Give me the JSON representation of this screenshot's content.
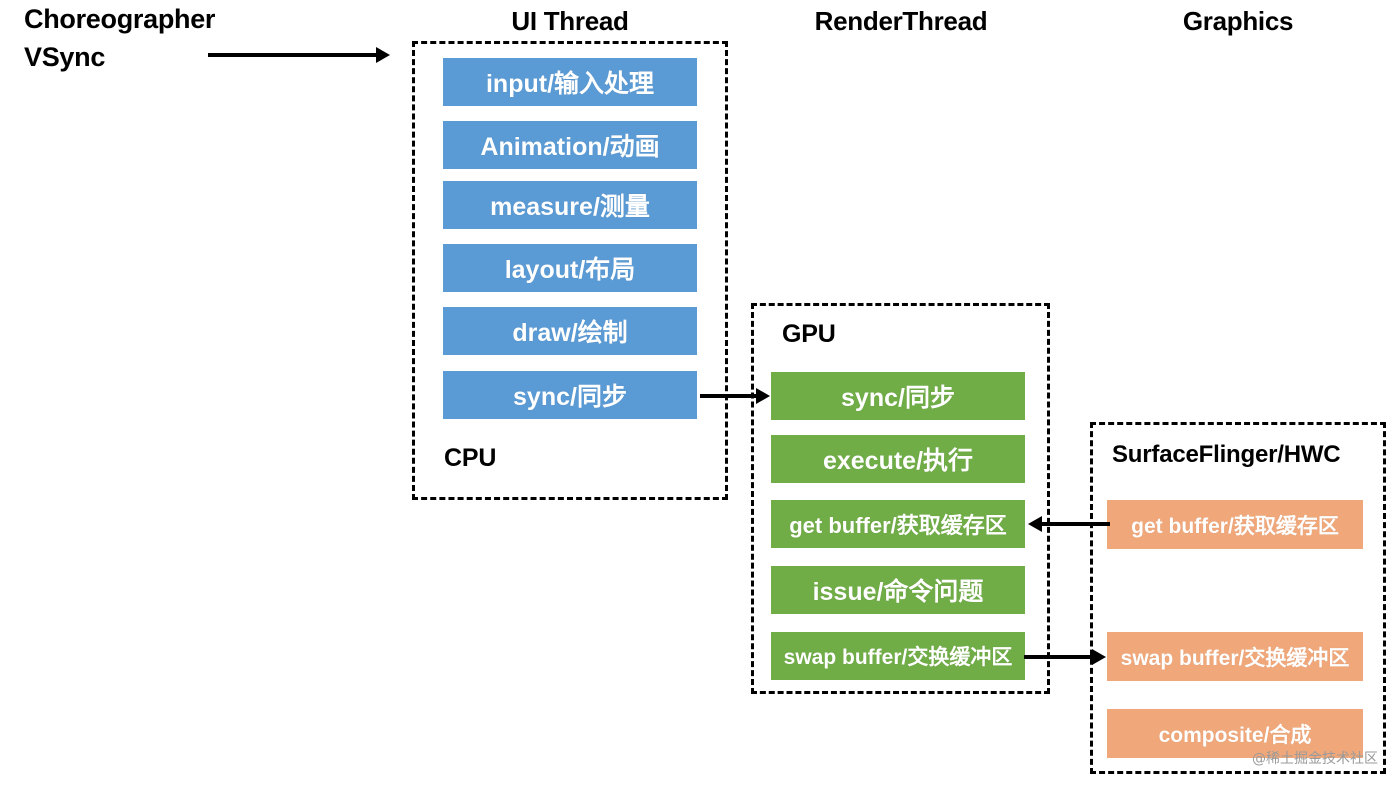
{
  "diagram": {
    "title_left": {
      "line1": "Choreographer",
      "line2": "VSync"
    },
    "column_headers": [
      {
        "label": "UI Thread"
      },
      {
        "label": "RenderThread"
      },
      {
        "label": "Graphics"
      }
    ],
    "zones": [
      {
        "id": "cpu",
        "label": "CPU",
        "label_position": "bottom-left",
        "color": "#5B9BD5",
        "steps": [
          {
            "label": "input/输入处理"
          },
          {
            "label": "Animation/动画"
          },
          {
            "label": "measure/测量"
          },
          {
            "label": "layout/布局"
          },
          {
            "label": "draw/绘制"
          },
          {
            "label": "sync/同步"
          }
        ]
      },
      {
        "id": "gpu",
        "label": "GPU",
        "label_position": "top-left",
        "color": "#70AD47",
        "steps": [
          {
            "label": "sync/同步"
          },
          {
            "label": "execute/执行"
          },
          {
            "label": "get buffer/获取缓存区"
          },
          {
            "label": "issue/命令问题"
          },
          {
            "label": "swap buffer/交换缓冲区"
          }
        ]
      },
      {
        "id": "surfaceflinger",
        "label": "SurfaceFlinger/HWC",
        "label_position": "top-left",
        "color": "#F0A87B",
        "steps": [
          {
            "label": "get buffer/获取缓存区"
          },
          {
            "label": "swap buffer/交换缓冲区"
          },
          {
            "label": "composite/合成"
          }
        ]
      }
    ],
    "arrows": [
      {
        "id": "vsync-to-ui",
        "direction": "right"
      },
      {
        "id": "cpu-sync-to-gpu-sync",
        "direction": "right"
      },
      {
        "id": "sf-getbuffer-to-gpu-getbuffer",
        "direction": "left"
      },
      {
        "id": "gpu-swapbuffer-to-sf-swapbuffer",
        "direction": "right"
      }
    ],
    "watermark": "@稀土掘金技术社区",
    "colors": {
      "blue": "#5B9BD5",
      "green": "#70AD47",
      "orange": "#F0A87B",
      "outline": "#000000",
      "background": "#FFFFFF"
    }
  }
}
